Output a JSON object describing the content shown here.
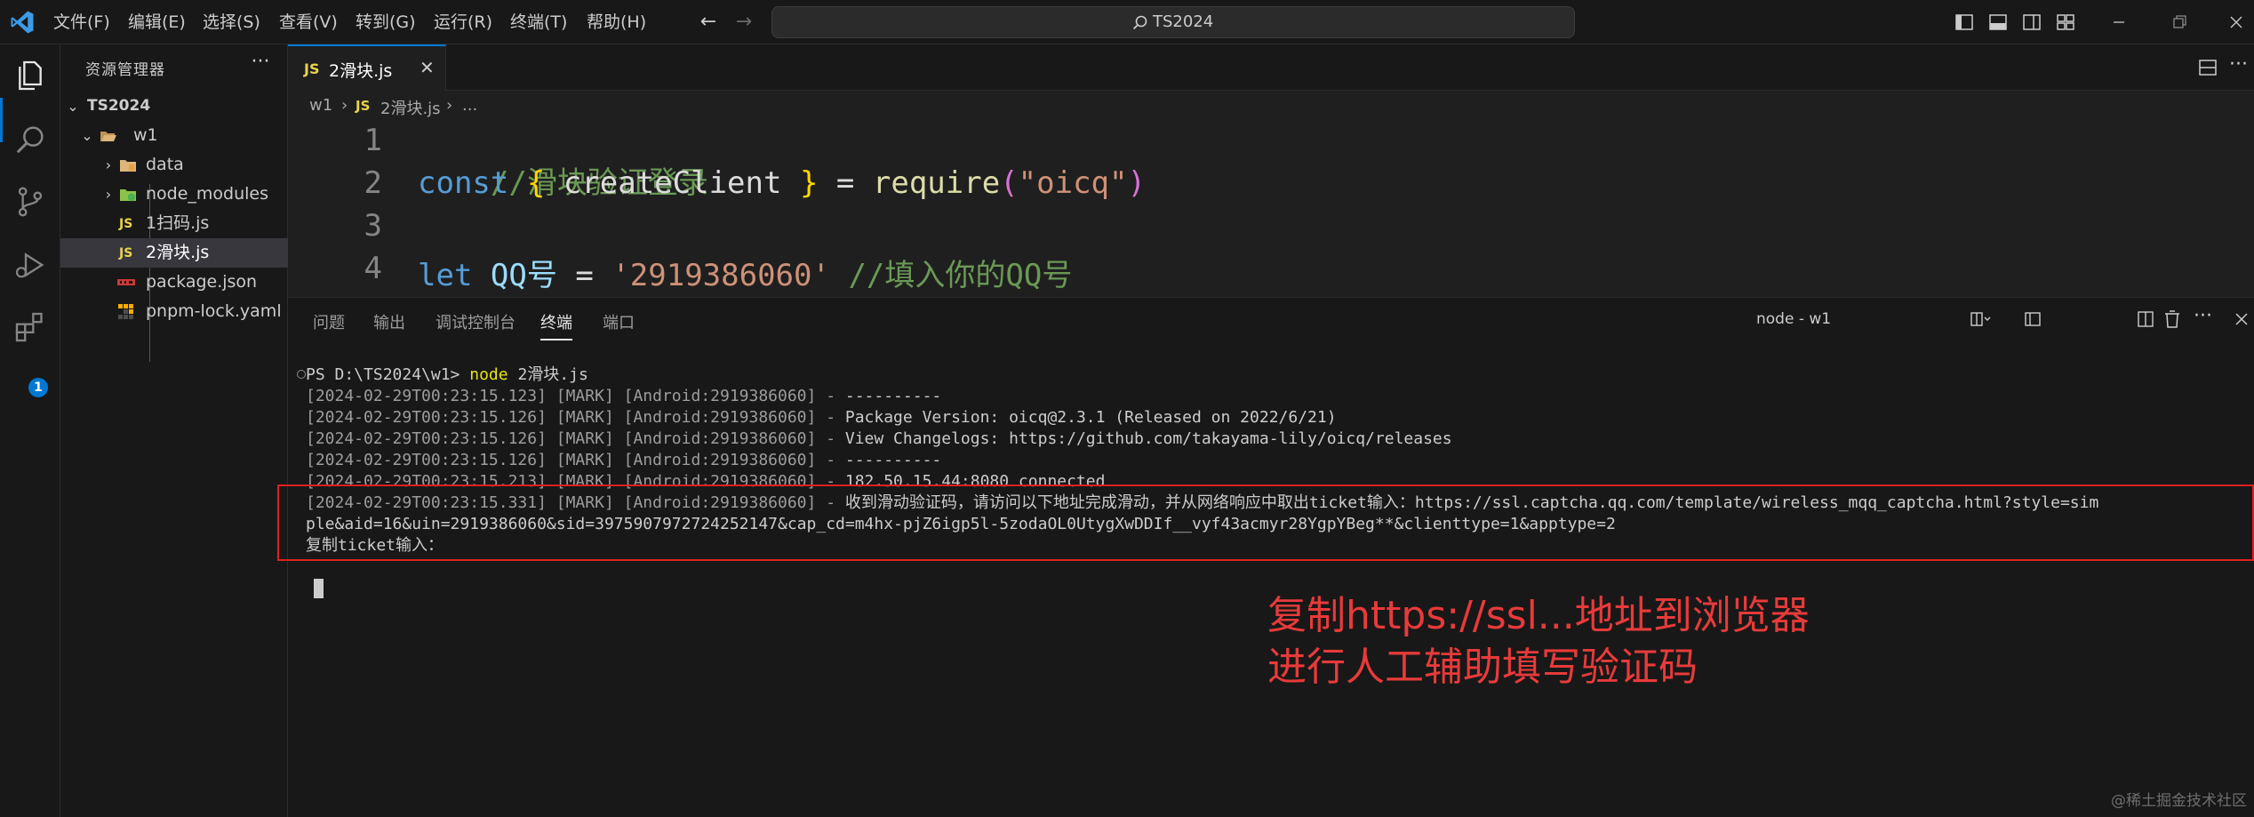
{
  "titlebar": {
    "menus": [
      "文件(F)",
      "编辑(E)",
      "选择(S)",
      "查看(V)",
      "转到(G)",
      "运行(R)",
      "终端(T)",
      "帮助(H)"
    ],
    "command_center": "TS2024"
  },
  "sidebar": {
    "title": "资源管理器",
    "more": "···",
    "root": "TS2024",
    "items": [
      {
        "label": "w1"
      },
      {
        "label": "data"
      },
      {
        "label": "node_modules"
      },
      {
        "label": "1扫码.js",
        "badge": "JS"
      },
      {
        "label": "2滑块.js",
        "badge": "JS"
      },
      {
        "label": "package.json"
      },
      {
        "label": "pnpm-lock.yaml"
      }
    ]
  },
  "activitybar": {
    "icons": [
      "explorer-icon",
      "search-icon",
      "source-control-icon",
      "run-debug-icon",
      "extensions-icon"
    ],
    "extensions_badge": "1"
  },
  "tab": {
    "badge": "JS",
    "label": "2滑块.js",
    "close": "✕"
  },
  "breadcrumb": {
    "folder": "w1",
    "sep1": "›",
    "badge": "JS",
    "file": "2滑块.js",
    "sep2": "›",
    "more": "..."
  },
  "editor": {
    "line_numbers": [
      "1",
      "2",
      "3",
      "4"
    ],
    "line1": "//滑块验证登录",
    "line2": {
      "kw": "const",
      "open": "{",
      "ident": "createClient",
      "close": "}",
      "eq": "=",
      "fn": "require",
      "lp": "(",
      "str": "\"oicq\"",
      "rp": ")"
    },
    "line4": {
      "kw": "let",
      "var": "QQ号",
      "eq": "=",
      "str": "'2919386060'",
      "cmt": "//填入你的QQ号"
    }
  },
  "panel": {
    "tabs": [
      "问题",
      "输出",
      "调试控制台",
      "终端",
      "端口"
    ],
    "active_tab": "终端",
    "terminal_name": "node - w1"
  },
  "terminal": {
    "prompt": "PS D:\\TS2024\\w1>",
    "command_word": "node",
    "command_arg": "2滑块.js",
    "lines": [
      {
        "prefix": "[2024-02-29T00:23:15.123] [MARK] [Android:2919386060] -",
        "text": " ----------"
      },
      {
        "prefix": "[2024-02-29T00:23:15.126] [MARK] [Android:2919386060] -",
        "text": " Package Version: oicq@2.3.1 (Released on 2022/6/21)"
      },
      {
        "prefix": "[2024-02-29T00:23:15.126] [MARK] [Android:2919386060] -",
        "text": " View Changelogs: https://github.com/takayama-lily/oicq/releases"
      },
      {
        "prefix": "[2024-02-29T00:23:15.126] [MARK] [Android:2919386060] -",
        "text": " ----------"
      },
      {
        "prefix": "[2024-02-29T00:23:15.213] [MARK] [Android:2919386060] -",
        "text": " 182.50.15.44:8080 connected"
      },
      {
        "prefix": "[2024-02-29T00:23:15.331] [MARK] [Android:2919386060] -",
        "text": " 收到滑动验证码，请访问以下地址完成滑动，并从网络响应中取出ticket输入：https://ssl.captcha.qq.com/template/wireless_mqq_captcha.html?style=sim"
      }
    ],
    "wrap_line": "ple&aid=16&uin=2919386060&sid=3975907972724252147&cap_cd=m4hx-pjZ6igp5l-5zodaOL0UtygXwDDIf__vyf43acmyr28YgpYBeg**&clienttype=1&apptype=2",
    "input_prompt": "复制ticket输入："
  },
  "annotation": {
    "line1": "复制https://ssl...地址到浏览器",
    "line2": "进行人工辅助填写验证码"
  },
  "watermark": "@稀土掘金技术社区",
  "colors": {
    "accent": "#0078d4",
    "highlight": "#e02020",
    "annotation": "#e83a3a"
  }
}
